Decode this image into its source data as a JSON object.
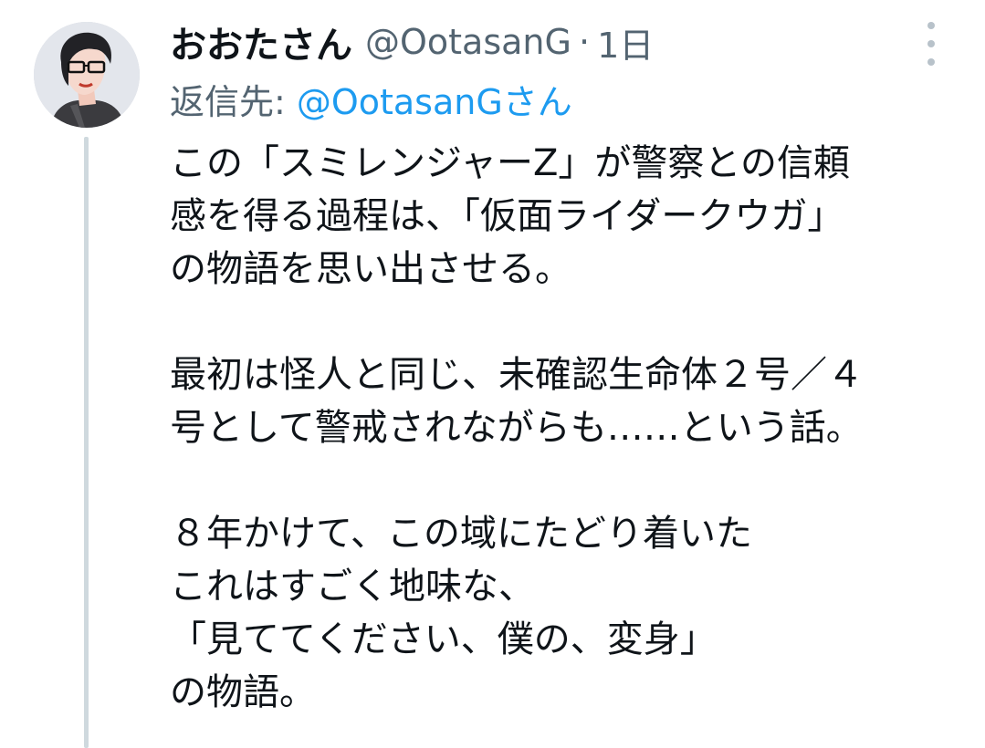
{
  "author": {
    "display_name": "おおたさん",
    "handle": "@OotasanG",
    "separator": "·",
    "time": "1日",
    "avatar_icon": "user-avatar-icon"
  },
  "reply": {
    "label": "返信先:",
    "target": "@OotasanGさん"
  },
  "menu": {
    "icon": "more-vertical-icon"
  },
  "body": {
    "lines": [
      "この「スミレンジャーZ」が警察との信頼",
      "感を得る過程は、「仮面ライダークウガ」",
      "の物語を思い出させる。",
      "",
      "最初は怪人と同じ、未確認生命体２号／４",
      "号として警戒されながらも……という話。",
      "",
      "８年かけて、この域にたどり着いた",
      "これはすごく地味な、",
      "「見ててください、僕の、変身」",
      "の物語。"
    ]
  },
  "colors": {
    "text": "#0f1419",
    "secondary": "#536471",
    "link": "#1d9bf0",
    "thread_line": "#cfd9de"
  }
}
